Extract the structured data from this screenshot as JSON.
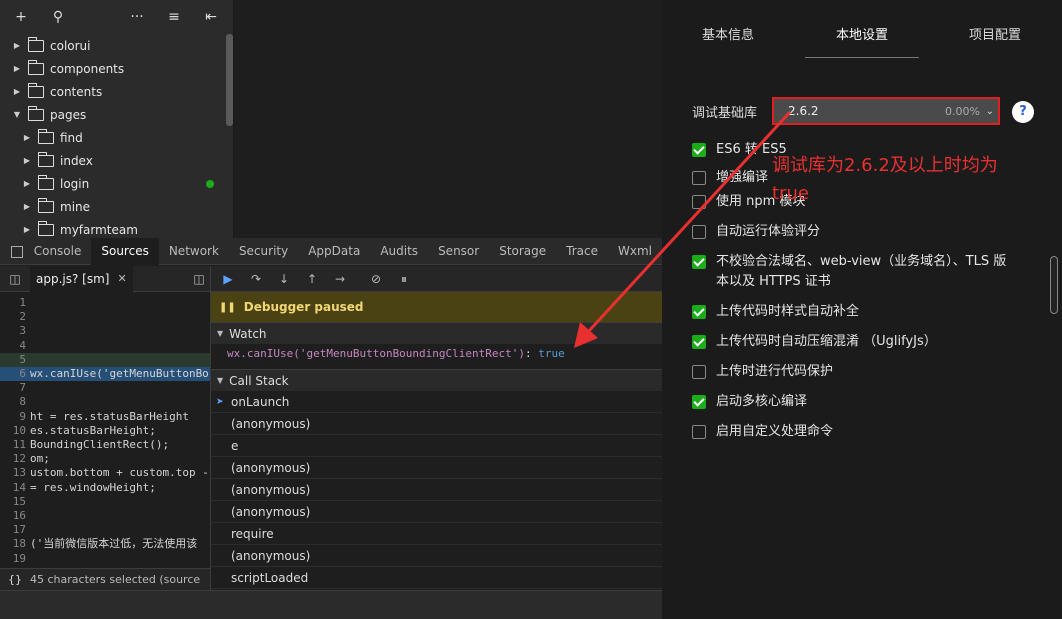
{
  "file_tree": {
    "items": [
      {
        "label": "colorui",
        "expanded": false,
        "indent": 0
      },
      {
        "label": "components",
        "expanded": false,
        "indent": 0
      },
      {
        "label": "contents",
        "expanded": false,
        "indent": 0
      },
      {
        "label": "pages",
        "expanded": true,
        "indent": 0
      },
      {
        "label": "find",
        "expanded": false,
        "indent": 1
      },
      {
        "label": "index",
        "expanded": false,
        "indent": 1
      },
      {
        "label": "login",
        "expanded": false,
        "indent": 1,
        "modified": true
      },
      {
        "label": "mine",
        "expanded": false,
        "indent": 1
      },
      {
        "label": "myfarmteam",
        "expanded": false,
        "indent": 1
      }
    ]
  },
  "devtools": {
    "tabs": [
      "Console",
      "Sources",
      "Network",
      "Security",
      "AppData",
      "Audits",
      "Sensor",
      "Storage",
      "Trace",
      "Wxml"
    ],
    "active_tab": "Sources"
  },
  "sources": {
    "file_tab": "app.js? [sm]",
    "status": "45 characters selected (source",
    "braces": "{}",
    "lines": [
      {
        "n": "1",
        "text": ""
      },
      {
        "n": "2",
        "text": ""
      },
      {
        "n": "3",
        "text": ""
      },
      {
        "n": "4",
        "text": ""
      },
      {
        "n": "5",
        "text": ""
      },
      {
        "n": "6",
        "text": "wx.canIUse('getMenuButtonBo"
      },
      {
        "n": "7",
        "text": ""
      },
      {
        "n": "8",
        "text": ""
      },
      {
        "n": "9",
        "text": "ht = res.statusBarHeight"
      },
      {
        "n": "10",
        "text": "es.statusBarHeight;"
      },
      {
        "n": "11",
        "text": "BoundingClientRect();"
      },
      {
        "n": "12",
        "text": "om;"
      },
      {
        "n": "13",
        "text": "ustom.bottom + custom.top -"
      },
      {
        "n": "14",
        "text": "= res.windowHeight;"
      },
      {
        "n": "15",
        "text": ""
      },
      {
        "n": "16",
        "text": ""
      },
      {
        "n": "17",
        "text": ""
      },
      {
        "n": "18",
        "text": "('当前微信版本过低，无法使用该"
      },
      {
        "n": "19",
        "text": ""
      }
    ]
  },
  "debugger": {
    "paused_label": "Debugger paused",
    "watch_header": "Watch",
    "watch_expr": "wx.canIUse('getMenuButtonBoundingClientRect')",
    "watch_colon": ": ",
    "watch_value": "true",
    "callstack_header": "Call Stack",
    "callstack": [
      "onLaunch",
      "(anonymous)",
      "e",
      "(anonymous)",
      "(anonymous)",
      "(anonymous)",
      "require",
      "(anonymous)",
      "scriptLoaded"
    ]
  },
  "settings": {
    "tabs": [
      "基本信息",
      "本地设置",
      "项目配置"
    ],
    "active_tab": "本地设置",
    "lib_label": "调试基础库",
    "lib_version": "2.6.2",
    "lib_percent": "0.00%",
    "help": "?",
    "options": [
      {
        "label": "ES6 转 ES5",
        "checked": true
      },
      {
        "label": "增强编译",
        "checked": false
      },
      {
        "label": "使用 npm 模块",
        "checked": false
      },
      {
        "label": "自动运行体验评分",
        "checked": false
      },
      {
        "label": "不校验合法域名、web-view（业务域名）、TLS 版本以及 HTTPS 证书",
        "checked": true
      },
      {
        "label": "上传代码时样式自动补全",
        "checked": true
      },
      {
        "label": "上传代码时自动压缩混淆 （UglifyJs）",
        "checked": true
      },
      {
        "label": "上传时进行代码保护",
        "checked": false
      },
      {
        "label": "启动多核心编译",
        "checked": true
      },
      {
        "label": "启用自定义处理命令",
        "checked": false
      }
    ]
  },
  "annotation": {
    "text": "调试库为2.6.2及以上时均为true",
    "color": "#e83030"
  },
  "colors": {
    "accent_green": "#1aad19",
    "paused_bg": "#4b4213",
    "highlight_red": "#e02020"
  }
}
